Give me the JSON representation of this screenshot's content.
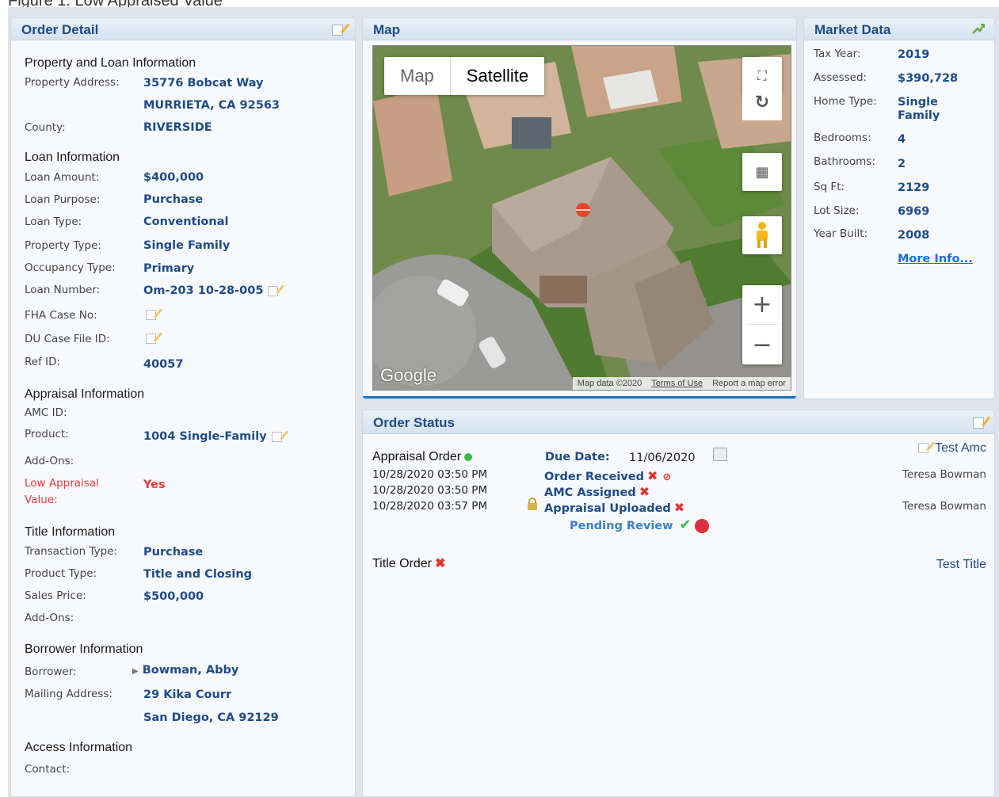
{
  "caption": "Figure 1: Low Appraised Value",
  "order_detail": {
    "title": "Order Detail",
    "property_section": "Property and Loan Information",
    "property_address_label": "Property Address:",
    "address_line1": "35776 Bobcat Way",
    "address_line2": "MURRIETA, CA 92563",
    "county_label": "County:",
    "county": "RIVERSIDE",
    "loan_section": "Loan Information",
    "loan_amount_label": "Loan Amount:",
    "loan_amount": "$400,000",
    "loan_purpose_label": "Loan Purpose:",
    "loan_purpose": "Purchase",
    "loan_type_label": "Loan Type:",
    "loan_type": "Conventional",
    "property_type_label": "Property Type:",
    "property_type": "Single Family",
    "occupancy_label": "Occupancy Type:",
    "occupancy": "Primary",
    "loan_number_label": "Loan Number:",
    "loan_number": "Om-203 10-28-005",
    "fha_label": "FHA Case No:",
    "du_label": "DU Case File ID:",
    "ref_label": "Ref ID:",
    "ref_id": "40057",
    "appraisal_section": "Appraisal Information",
    "amc_label": "AMC ID:",
    "product_label": "Product:",
    "product": "1004 Single-Family",
    "addons_label": "Add-Ons:",
    "low_appraisal_label_1": "Low Appraisal",
    "low_appraisal_label_2": "Value:",
    "low_appraisal_value": "Yes",
    "title_section": "Title Information",
    "transaction_label": "Transaction Type:",
    "transaction": "Purchase",
    "product_type_label": "Product Type:",
    "product_type": "Title and Closing",
    "sales_price_label": "Sales Price:",
    "sales_price": "$500,000",
    "title_addons_label": "Add-Ons:",
    "borrower_section": "Borrower Information",
    "borrower_label": "Borrower:",
    "borrower": "Bowman, Abby",
    "mailing_label": "Mailing Address:",
    "mailing_line1": "29 Kika Courr",
    "mailing_line2": "San Diego, CA 92129",
    "access_section": "Access Information",
    "contact_label": "Contact:"
  },
  "map": {
    "title": "Map",
    "toggle_map": "Map",
    "toggle_satellite": "Satellite",
    "google": "Google",
    "map_data": "Map data ©2020",
    "terms": "Terms of Use",
    "report": "Report a map error"
  },
  "market": {
    "title": "Market Data",
    "tax_year_label": "Tax Year:",
    "tax_year": "2019",
    "assessed_label": "Assessed:",
    "assessed": "$390,728",
    "home_type_label": "Home Type:",
    "home_type_1": "Single",
    "home_type_2": "Family",
    "bedrooms_label": "Bedrooms:",
    "bedrooms": "4",
    "bathrooms_label": "Bathrooms:",
    "bathrooms": "2",
    "sqft_label": "Sq Ft:",
    "sqft": "2129",
    "lot_label": "Lot Size:",
    "lot": "6969",
    "year_label": "Year Built:",
    "year": "2008",
    "more": "More Info..."
  },
  "status": {
    "title": "Order Status",
    "appraisal_order": "Appraisal Order",
    "due_date_label": "Due Date:",
    "due_date": "11/06/2020",
    "test_amc": "Test Amc",
    "dates": [
      "10/28/2020 03:50 PM",
      "10/28/2020 03:50 PM",
      "10/28/2020 03:57 PM"
    ],
    "order_received": "Order Received",
    "amc_assigned": "AMC Assigned",
    "appraisal_uploaded": "Appraisal Uploaded",
    "pending_review": "Pending Review",
    "person1": "Teresa Bowman",
    "person2": "Teresa Bowman",
    "title_order": "Title Order",
    "test_title": "Test Title"
  },
  "colors": {
    "accent": "#1f4b86",
    "alert": "#e63b3b",
    "ok": "#3cb84a"
  }
}
